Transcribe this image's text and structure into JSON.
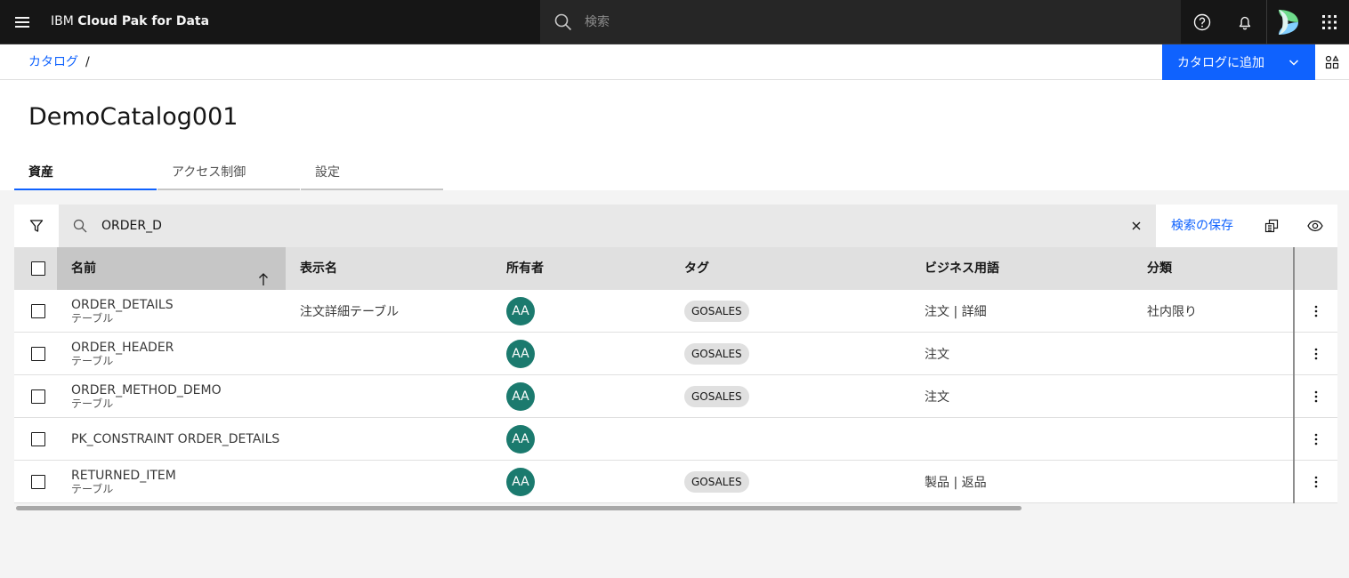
{
  "header": {
    "brand_prefix": "IBM",
    "brand_name": "Cloud Pak for Data",
    "search_placeholder": "検索",
    "icons": [
      "menu-icon",
      "search-icon",
      "help-icon",
      "notification-icon",
      "avatar",
      "app-switcher-icon"
    ]
  },
  "breadcrumb": {
    "item": "カタログ",
    "separator": "/"
  },
  "actions": {
    "add_to_catalog": "カタログに追加"
  },
  "page": {
    "title": "DemoCatalog001"
  },
  "tabs": [
    {
      "label": "資産",
      "active": true
    },
    {
      "label": "アクセス制御",
      "active": false
    },
    {
      "label": "設定",
      "active": false
    }
  ],
  "toolbar": {
    "search_value": "ORDER_D",
    "save_search": "検索の保存"
  },
  "table": {
    "columns": [
      "名前",
      "表示名",
      "所有者",
      "タグ",
      "ビジネス用語",
      "分類"
    ],
    "sorted_column": "名前",
    "rows": [
      {
        "name": "ORDER_DETAILS",
        "type": "テーブル",
        "display_name": "注文詳細テーブル",
        "owner": "AA",
        "tag": "GOSALES",
        "terms": "注文 | 詳細",
        "classification": "社内限り"
      },
      {
        "name": "ORDER_HEADER",
        "type": "テーブル",
        "display_name": "",
        "owner": "AA",
        "tag": "GOSALES",
        "terms": "注文",
        "classification": ""
      },
      {
        "name": "ORDER_METHOD_DEMO",
        "type": "テーブル",
        "display_name": "",
        "owner": "AA",
        "tag": "GOSALES",
        "terms": "注文",
        "classification": ""
      },
      {
        "name": "PK_CONSTRAINT ORDER_DETAILS",
        "type": "",
        "display_name": "",
        "owner": "AA",
        "tag": "",
        "terms": "",
        "classification": ""
      },
      {
        "name": "RETURNED_ITEM",
        "type": "テーブル",
        "display_name": "",
        "owner": "AA",
        "tag": "GOSALES",
        "terms": "製品 | 返品",
        "classification": ""
      }
    ]
  },
  "colors": {
    "primary": "#0f62fe",
    "header_bg": "#161616",
    "avatar": "#1b7a6e"
  }
}
